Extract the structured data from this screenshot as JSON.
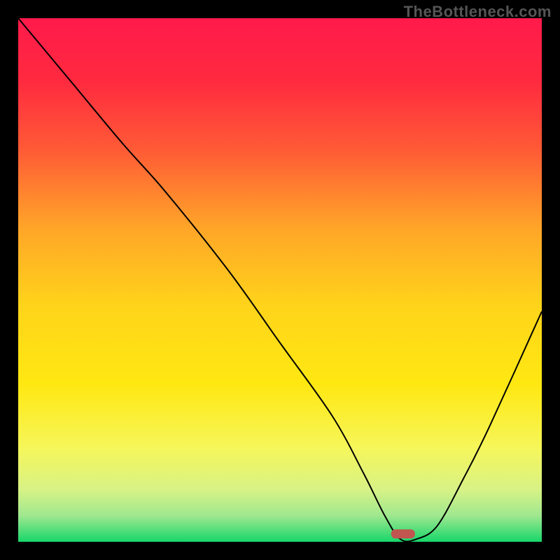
{
  "watermark": "TheBottleneck.com",
  "chart_data": {
    "type": "line",
    "title": "",
    "xlabel": "",
    "ylabel": "",
    "xlim": [
      0,
      100
    ],
    "ylim": [
      0,
      100
    ],
    "grid": false,
    "legend": false,
    "x": [
      0,
      10,
      20,
      28,
      40,
      50,
      60,
      66,
      70,
      73,
      76,
      80,
      85,
      90,
      100
    ],
    "values": [
      100,
      88,
      76,
      67,
      52,
      38,
      24,
      13,
      5,
      0.5,
      0.5,
      3,
      12,
      22,
      44
    ],
    "marker": {
      "x": 73.5,
      "y": 1.5
    },
    "gradient_stops": [
      {
        "offset": 0.0,
        "color": "#ff1a4b"
      },
      {
        "offset": 0.12,
        "color": "#ff2a3f"
      },
      {
        "offset": 0.25,
        "color": "#ff5a36"
      },
      {
        "offset": 0.4,
        "color": "#ffa528"
      },
      {
        "offset": 0.55,
        "color": "#ffd41a"
      },
      {
        "offset": 0.7,
        "color": "#ffe812"
      },
      {
        "offset": 0.82,
        "color": "#f6f65a"
      },
      {
        "offset": 0.9,
        "color": "#d8f285"
      },
      {
        "offset": 0.95,
        "color": "#9fe88f"
      },
      {
        "offset": 1.0,
        "color": "#17d66a"
      }
    ],
    "marker_fill": "#c0564f",
    "line_color": "#000000",
    "line_width": 2
  }
}
